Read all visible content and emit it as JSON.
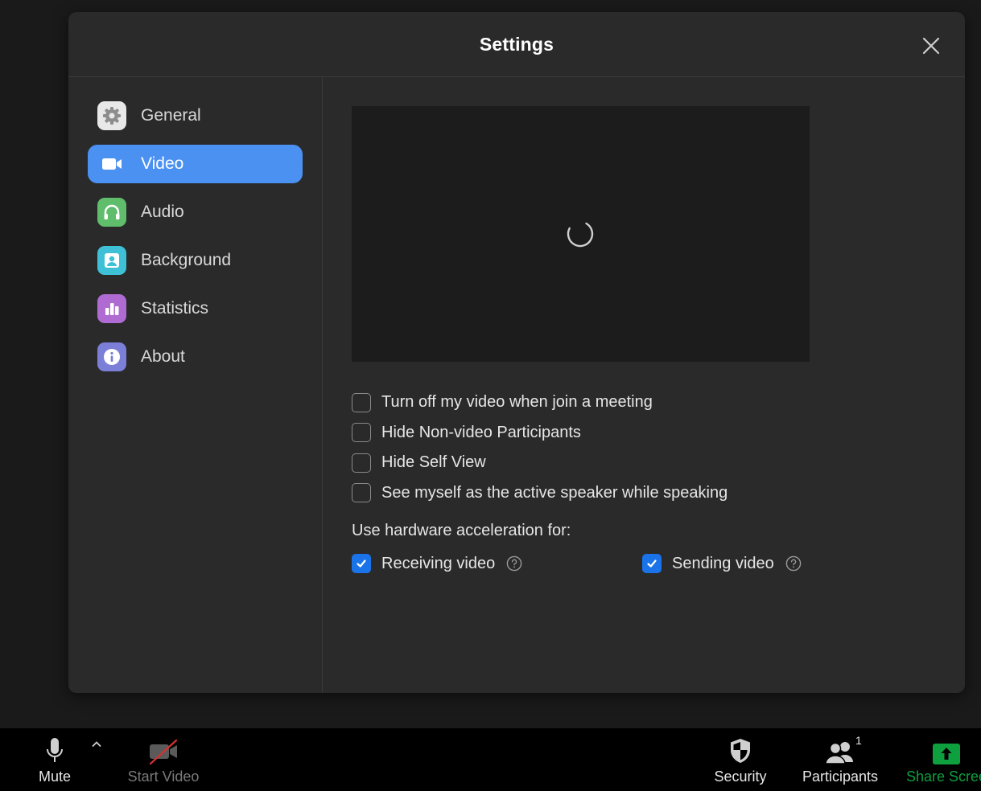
{
  "modal": {
    "title": "Settings"
  },
  "sidebar": {
    "items": [
      {
        "label": "General",
        "icon": "gear-icon",
        "color": "#e8e8e8",
        "active": false
      },
      {
        "label": "Video",
        "icon": "video-camera-icon",
        "color": "#4a91f2",
        "active": true
      },
      {
        "label": "Audio",
        "icon": "headphones-icon",
        "color": "#5fbd6c",
        "active": false
      },
      {
        "label": "Background",
        "icon": "portrait-icon",
        "color": "#3ec0d6",
        "active": false
      },
      {
        "label": "Statistics",
        "icon": "bar-chart-icon",
        "color": "#b06bd3",
        "active": false
      },
      {
        "label": "About",
        "icon": "info-icon",
        "color": "#7b7fd8",
        "active": false
      }
    ]
  },
  "video": {
    "options": [
      {
        "label": "Turn off my video when join a meeting",
        "checked": false
      },
      {
        "label": "Hide Non-video Participants",
        "checked": false
      },
      {
        "label": "Hide Self View",
        "checked": false
      },
      {
        "label": "See myself as the active speaker while speaking",
        "checked": false
      }
    ],
    "hardware_title": "Use hardware acceleration for:",
    "hardware": [
      {
        "label": "Receiving video",
        "checked": true
      },
      {
        "label": "Sending video",
        "checked": true
      }
    ]
  },
  "toolbar": {
    "mute_label": "Mute",
    "start_video_label": "Start Video",
    "security_label": "Security",
    "participants_label": "Participants",
    "participants_count": "1",
    "share_label": "Share Scree"
  },
  "colors": {
    "accent": "#4a91f2",
    "checkbox": "#1a73e8",
    "share_green": "#0e9f3e"
  }
}
